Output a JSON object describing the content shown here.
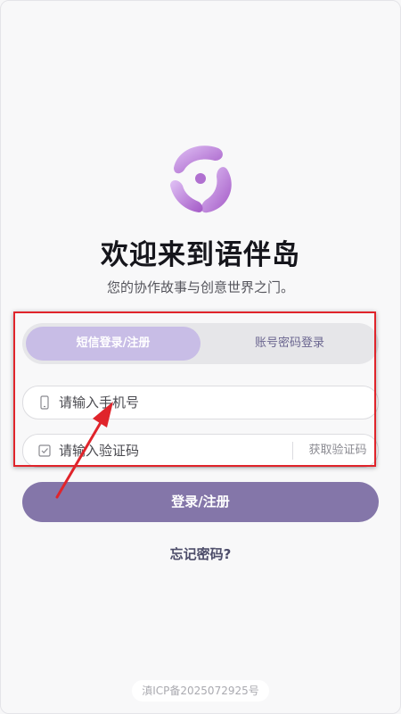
{
  "app": {
    "title": "欢迎来到语伴岛",
    "subtitle": "您的协作故事与创意世界之门。"
  },
  "tabs": [
    {
      "label": "短信登录/注册",
      "active": true
    },
    {
      "label": "账号密码登录",
      "active": false
    }
  ],
  "phone_field": {
    "placeholder": "请输入手机号",
    "icon": "phone-icon"
  },
  "code_field": {
    "placeholder": "请输入验证码",
    "icon": "checkbox-icon",
    "action_label": "获取验证码"
  },
  "login_button": {
    "label": "登录/注册"
  },
  "forgot_link": {
    "label": "忘记密码?"
  },
  "footer": {
    "icp": "滇ICP备2025072925号"
  },
  "colors": {
    "accent": "#8476a9",
    "tab_active": "#c8bde6",
    "logo_light": "#dcbcf2",
    "logo_dark": "#a65fc8",
    "annotation": "#e0242b"
  }
}
